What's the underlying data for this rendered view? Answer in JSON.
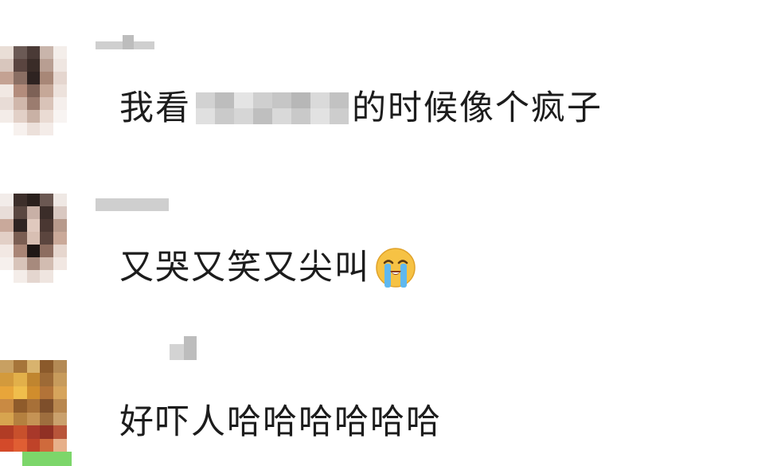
{
  "comments": [
    {
      "user_label": "",
      "text_before": "我看",
      "text_after": "的时候像个疯子",
      "avatar_colors": [
        "#e9ded6",
        "#6b5a55",
        "#4a3a36",
        "#c9b5ab",
        "#f4eeea",
        "#d8c6bd",
        "#5a4540",
        "#3a2c28",
        "#b89e92",
        "#efe6e1",
        "#c4a293",
        "#8a6e63",
        "#2e2321",
        "#a88777",
        "#e5d6cf",
        "#f1e8e3",
        "#b38c7c",
        "#7d6156",
        "#c6a898",
        "#ede2dc",
        "#e8dcd6",
        "#d0b7ab",
        "#9b7c6f",
        "#d9c3b8",
        "#f5efec",
        "#f3ece8",
        "#e2d0c7",
        "#c9b1a5",
        "#eadbd3",
        "#f8f4f2",
        "#ffffff",
        "#f7f1ee",
        "#ece0da",
        "#f4ece8",
        "#ffffff"
      ]
    },
    {
      "user_label": "",
      "text": "又哭又笑又尖叫",
      "emoji": "loudly-crying-face-icon",
      "avatar_colors": [
        "#f2ece9",
        "#3d2f2b",
        "#2a201d",
        "#6b5852",
        "#efe8e4",
        "#e8ddd8",
        "#5a4741",
        "#c8b0a6",
        "#3b2d29",
        "#d9c8c1",
        "#c9a99b",
        "#2f2422",
        "#e0c9be",
        "#4a3732",
        "#b79a8c",
        "#e2cfc6",
        "#7a5d52",
        "#d8bfb3",
        "#5b453e",
        "#caa999",
        "#f2e8e3",
        "#a98576",
        "#1f1715",
        "#8d6d60",
        "#e6d6ce",
        "#f6f0ed",
        "#d8c4ba",
        "#a78a7d",
        "#d2bcb1",
        "#f1e7e2",
        "#ffffff",
        "#f4ede9",
        "#e4d6cf",
        "#efe5e0",
        "#ffffff"
      ]
    },
    {
      "user_label": "",
      "text": "好吓人哈哈哈哈哈哈",
      "avatar_colors": [
        "#c8a062",
        "#a6753a",
        "#d8b36e",
        "#8b5a2b",
        "#b48a55",
        "#d39a3c",
        "#e2b04a",
        "#c0852f",
        "#9d6a36",
        "#c79b5c",
        "#e8a53a",
        "#f0be4c",
        "#d08d2d",
        "#b27338",
        "#d6a45c",
        "#c98a43",
        "#8f5b2b",
        "#a77038",
        "#7e4f2b",
        "#b8874f",
        "#d7a44f",
        "#b4803f",
        "#c59355",
        "#9e6e3e",
        "#caa16d",
        "#b13c25",
        "#c8502c",
        "#a8382a",
        "#903024",
        "#b8553a",
        "#d34a2a",
        "#e05e33",
        "#bf4329",
        "#cf6a3c",
        "#e7b08a"
      ]
    }
  ],
  "colors": {
    "text": "#1c1c1c",
    "placeholder": "#cfcfcf",
    "badge": "#7cd66a"
  }
}
